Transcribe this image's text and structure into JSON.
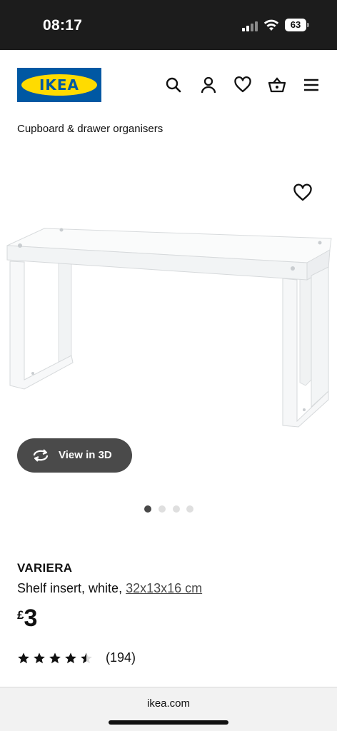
{
  "status_bar": {
    "time": "08:17",
    "battery": "63",
    "icons": [
      "signal-icon",
      "wifi-icon",
      "battery-icon"
    ]
  },
  "header": {
    "logo_text": "IKEA",
    "icons": [
      "search-icon",
      "user-icon",
      "heart-icon",
      "basket-icon",
      "menu-icon"
    ]
  },
  "breadcrumb": "Cupboard & drawer organisers",
  "gallery": {
    "image_subject": "shelf-insert-image",
    "view3d_label": "View in 3D",
    "dots_total": 4,
    "active_dot": 0
  },
  "product": {
    "name": "VARIERA",
    "description": "Shelf insert, white, ",
    "size": "32x13x16 cm",
    "currency": "£",
    "price": "3",
    "rating": 4.5,
    "review_count": "(194)"
  },
  "browser": {
    "url": "ikea.com"
  },
  "colors": {
    "brand_blue": "#0058a3",
    "brand_yellow": "#ffdb00",
    "button_dark": "#4a4a4a"
  }
}
